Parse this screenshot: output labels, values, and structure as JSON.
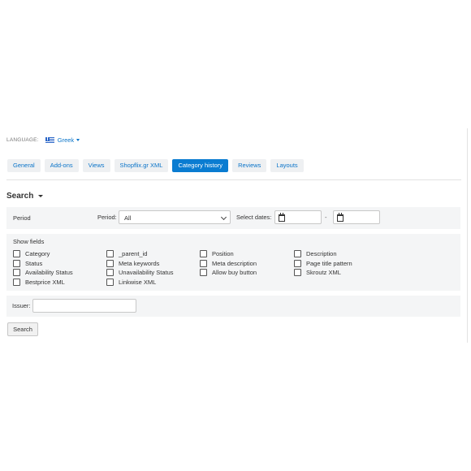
{
  "language": {
    "label": "LANGUAGE:",
    "value": "Greek",
    "flag": "greek-flag-icon"
  },
  "tabs": [
    {
      "label": "General",
      "active": false
    },
    {
      "label": "Add-ons",
      "active": false
    },
    {
      "label": "Views",
      "active": false
    },
    {
      "label": "Shopflix.gr XML",
      "active": false
    },
    {
      "label": "Category history",
      "active": true
    },
    {
      "label": "Reviews",
      "active": false
    },
    {
      "label": "Layouts",
      "active": false
    }
  ],
  "search": {
    "title": "Search",
    "period_row_label": "Period",
    "period_label": "Period:",
    "period_value": "All",
    "select_dates_label": "Select dates:",
    "date_separator": "-",
    "date_from": "",
    "date_to": "",
    "show_fields_label": "Show fields",
    "fields": [
      {
        "label": "Category",
        "checked": false
      },
      {
        "label": "Status",
        "checked": false
      },
      {
        "label": "Availability Status",
        "checked": false
      },
      {
        "label": "Bestprice XML",
        "checked": false
      },
      {
        "label": "_parent_id",
        "checked": false
      },
      {
        "label": "Meta keywords",
        "checked": false
      },
      {
        "label": "Unavailability Status",
        "checked": false
      },
      {
        "label": "Linkwise XML",
        "checked": false
      },
      {
        "label": "Position",
        "checked": false
      },
      {
        "label": "Meta description",
        "checked": false
      },
      {
        "label": "Allow buy button",
        "checked": false
      },
      {
        "label": "Description",
        "checked": false
      },
      {
        "label": "Page title pattern",
        "checked": false
      },
      {
        "label": "Skroutz XML",
        "checked": false
      }
    ],
    "issuer_label": "Issuer:",
    "issuer_value": "",
    "button_label": "Search"
  },
  "colors": {
    "accent": "#0a7cd1",
    "link": "#0a74c9",
    "panel": "#f4f5f6"
  }
}
